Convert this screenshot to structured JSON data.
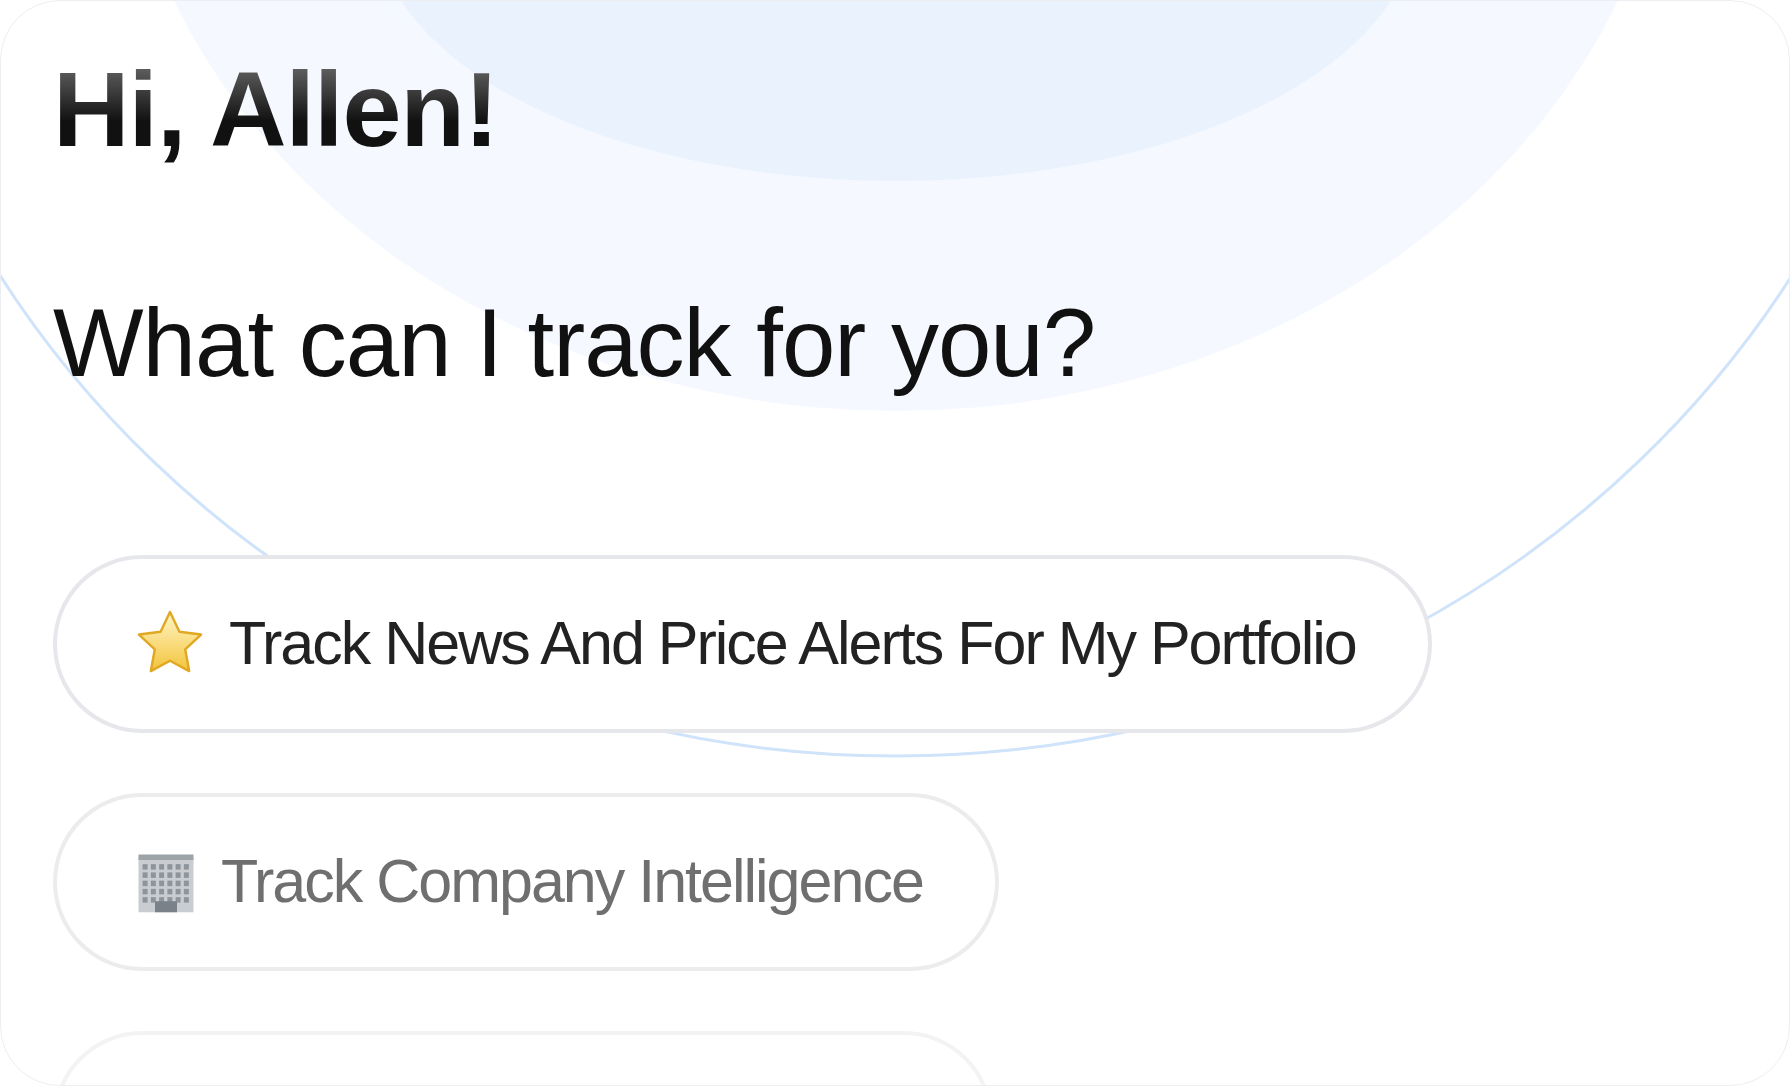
{
  "greeting": "Hi, Allen!",
  "prompt": "What can I track for you?",
  "suggestions": [
    {
      "kind": "star",
      "label": "Track News And Price Alerts For My Portfolio",
      "muted": false
    },
    {
      "kind": "building",
      "label": "Track Company Intelligence",
      "muted": true
    },
    {
      "kind": "blank"
    }
  ]
}
